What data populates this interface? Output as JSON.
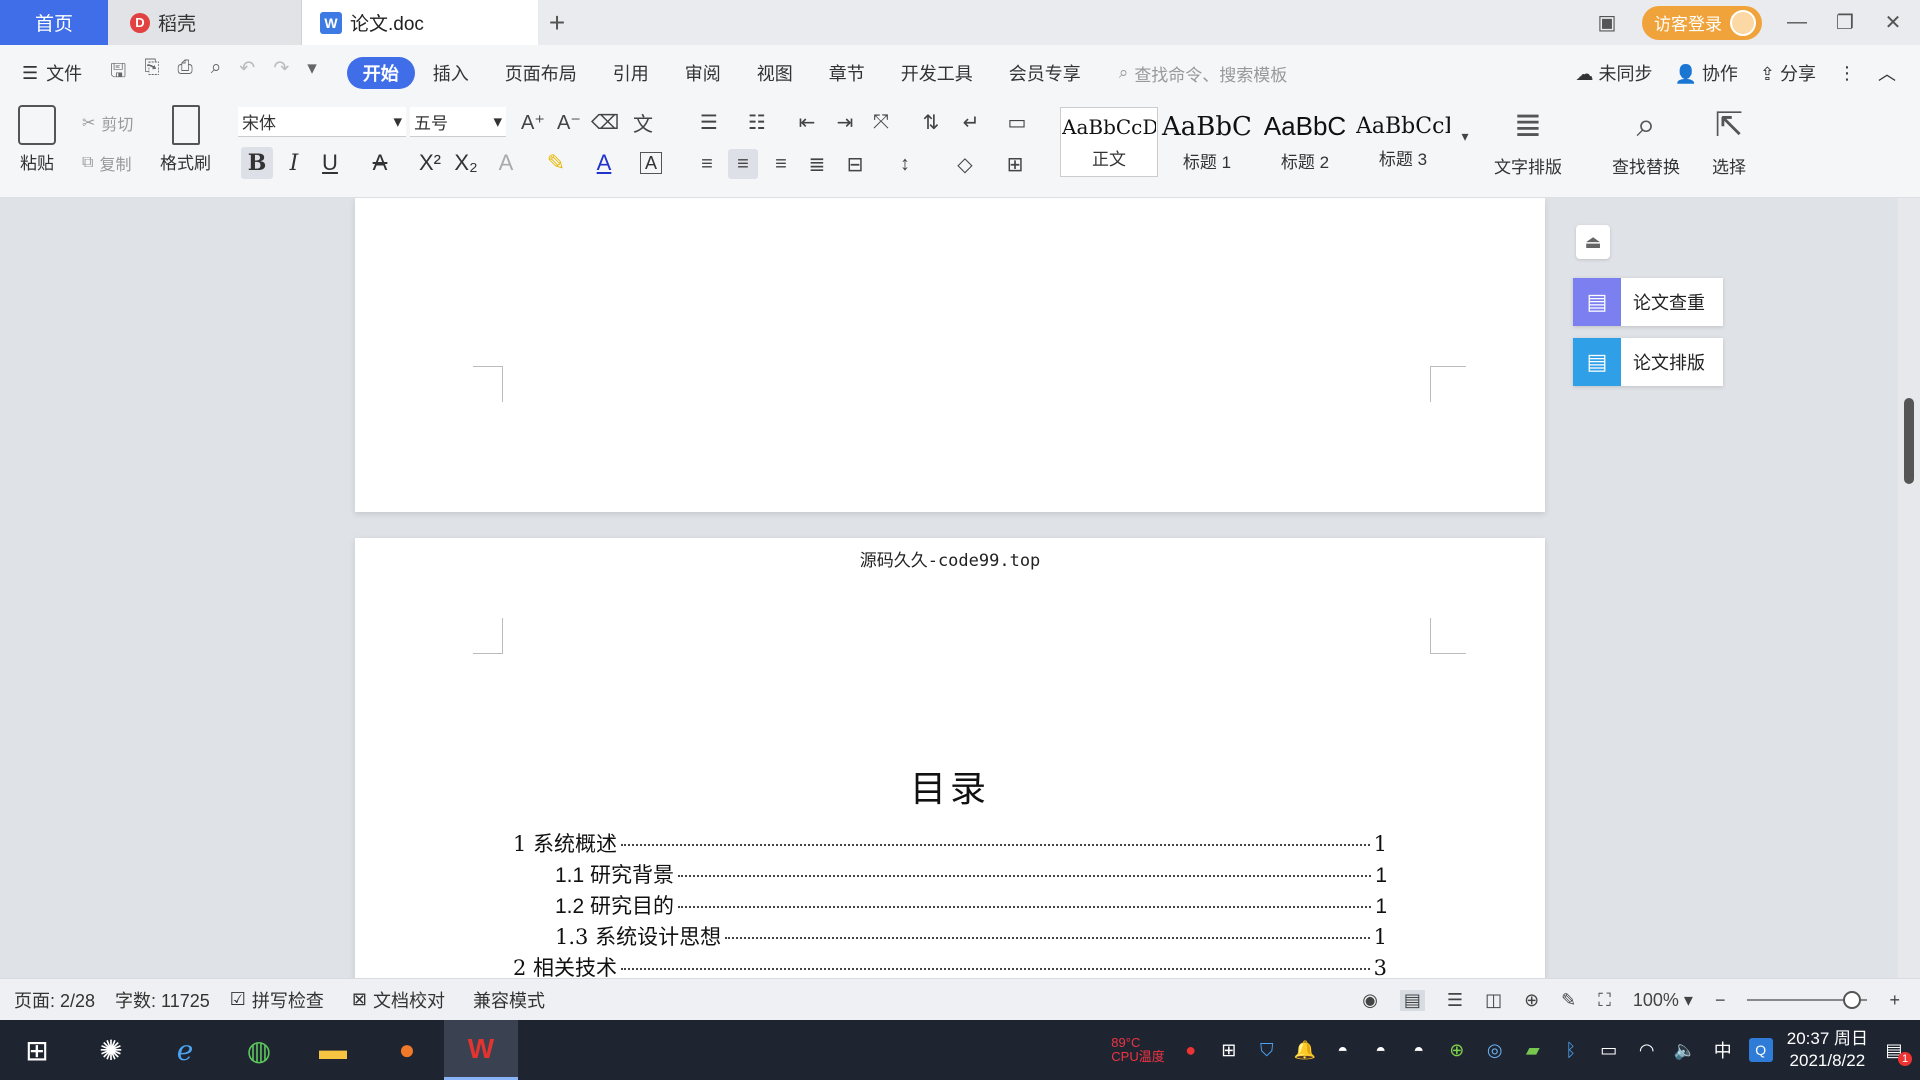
{
  "tabs": {
    "home": "首页",
    "daoke": "稻壳",
    "doc": "论文.doc",
    "add": "+"
  },
  "titlebar": {
    "login": "访客登录"
  },
  "menu": {
    "file": "文件",
    "tabs": [
      "开始",
      "插入",
      "页面布局",
      "引用",
      "审阅",
      "视图",
      "章节",
      "开发工具",
      "会员专享"
    ],
    "search_placeholder": "查找命令、搜索模板",
    "unsynced": "未同步",
    "collab": "协作",
    "share": "分享"
  },
  "ribbon": {
    "paste": "粘贴",
    "cut": "剪切",
    "copy": "复制",
    "format_painter": "格式刷",
    "font_name": "宋体",
    "font_size": "五号",
    "styles": [
      {
        "sample": "AaBbCcDd",
        "label": "正文"
      },
      {
        "sample": "AaBbC",
        "label": "标题 1"
      },
      {
        "sample": "AaBbC",
        "label": "标题 2"
      },
      {
        "sample": "AaBbCcI",
        "label": "标题 3"
      }
    ],
    "text_layout": "文字排版",
    "find_replace": "查找替换",
    "select": "选择"
  },
  "float_panel": {
    "paper_check": "论文查重",
    "paper_layout": "论文排版"
  },
  "document": {
    "header": "源码久久-code99.top",
    "toc_title": "目录",
    "toc": [
      {
        "text": "1 系统概述",
        "page": "1"
      },
      {
        "text": "1.1  研究背景",
        "page": "1"
      },
      {
        "text": "1.2 研究目的",
        "page": "1"
      },
      {
        "text": "1.3 系统设计思想",
        "page": "1"
      },
      {
        "text": "2 相关技术",
        "page": "3"
      }
    ]
  },
  "statusbar": {
    "page": "页面: 2/28",
    "words": "字数: 11725",
    "spell": "拼写检查",
    "proof": "文档校对",
    "compat": "兼容模式",
    "zoom": "100%",
    "zoom_level_percent": 100
  },
  "taskbar": {
    "cpu_temp": "89°C",
    "cpu_label": "CPU温度",
    "ime": "中",
    "time": "20:37 周日",
    "date": "2021/8/22",
    "notif_count": "1"
  },
  "colors": {
    "accent": "#3f6ee8",
    "login": "#f0a33a",
    "taskbar": "#1f2530"
  }
}
